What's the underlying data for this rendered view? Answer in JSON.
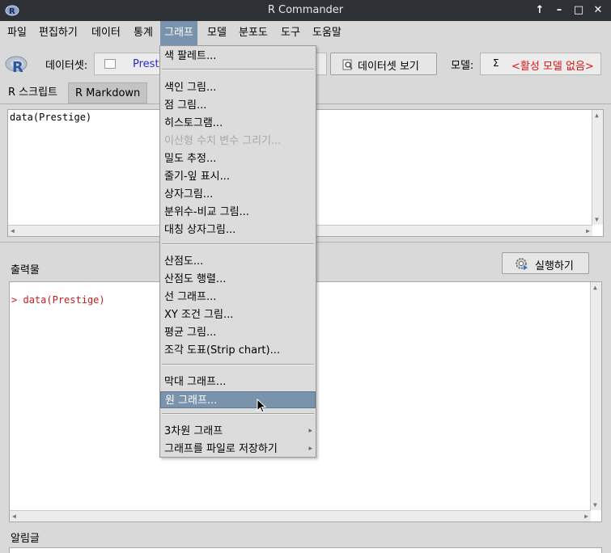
{
  "window": {
    "title": "R Commander"
  },
  "menubar": {
    "items": [
      {
        "label": "파일"
      },
      {
        "label": "편집하기"
      },
      {
        "label": "데이터"
      },
      {
        "label": "통계"
      },
      {
        "label": "그래프"
      },
      {
        "label": "모델"
      },
      {
        "label": "분포도"
      },
      {
        "label": "도구"
      },
      {
        "label": "도움말"
      }
    ],
    "active_index": 4
  },
  "toolbar": {
    "dataset_label": "데이터셋:",
    "dataset_name": "Presti",
    "view_dataset_button": "데이터셋 보기",
    "model_label": "모델:",
    "model_sigma": "Σ",
    "model_value": "<활성 모델 없음>"
  },
  "tabs": [
    {
      "label": "R 스크립트",
      "selected": true
    },
    {
      "label": "R Markdown",
      "selected": false
    }
  ],
  "script": {
    "content": "data(Prestige)"
  },
  "output": {
    "label": "출력물",
    "run_button": "실행하기",
    "lines": [
      {
        "prompt": ">",
        "text": "data(Prestige)"
      }
    ]
  },
  "messages": {
    "label": "알림글"
  },
  "graph_menu": {
    "items": [
      {
        "label": "색 팔레트..."
      },
      {
        "label": "색인 그림..."
      },
      {
        "label": "점 그림..."
      },
      {
        "label": "히스토그램..."
      },
      {
        "label": "이산형 수치 변수 그리기...",
        "disabled": true
      },
      {
        "label": "밀도 추정..."
      },
      {
        "label": "줄기-잎 표시..."
      },
      {
        "label": "상자그림..."
      },
      {
        "label": "분위수-비교 그림..."
      },
      {
        "label": "대칭 상자그림..."
      },
      {
        "label": "산점도..."
      },
      {
        "label": "산점도 행렬..."
      },
      {
        "label": "선 그래프..."
      },
      {
        "label": "XY 조건 그림..."
      },
      {
        "label": "평균 그림..."
      },
      {
        "label": "조각 도표(Strip chart)..."
      },
      {
        "label": "막대 그래프..."
      },
      {
        "label": "원 그래프...",
        "hover": true
      },
      {
        "label": "3차원 그래프",
        "submenu": true
      },
      {
        "label": "그래프를 파일로 저장하기",
        "submenu": true
      }
    ]
  },
  "colors": {
    "accent": "#7a93ad",
    "titlebar": "#2d3035",
    "warning": "#e01010",
    "dataset": "#2a2acc"
  }
}
